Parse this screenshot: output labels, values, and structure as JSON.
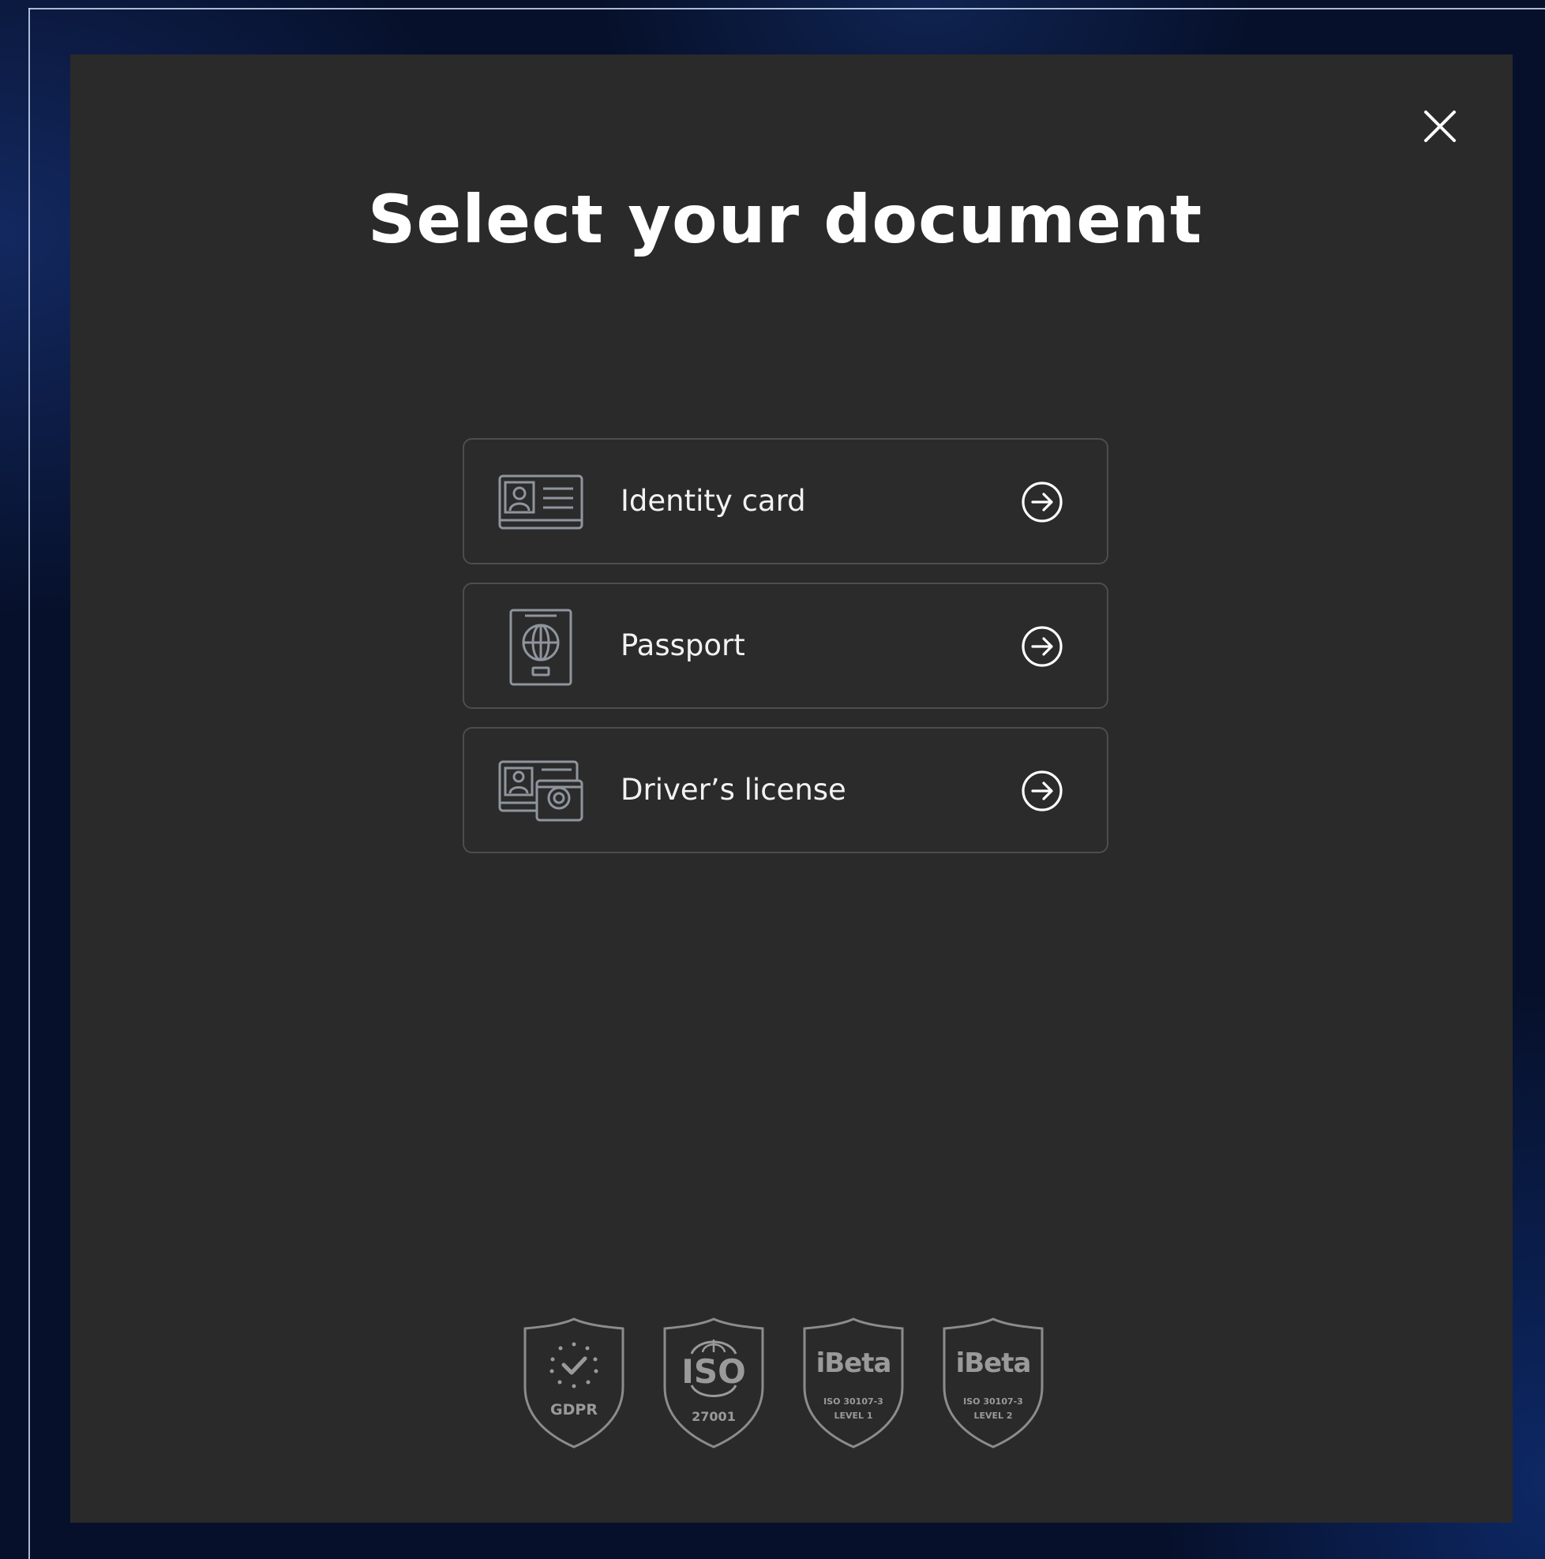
{
  "modal": {
    "title": "Select your document"
  },
  "documents": [
    {
      "label": "Identity card",
      "icon": "id-card-icon"
    },
    {
      "label": "Passport",
      "icon": "passport-icon"
    },
    {
      "label": "Driver’s license",
      "icon": "drivers-license-icon"
    }
  ],
  "badges": [
    {
      "title": "GDPR",
      "subtitle": ""
    },
    {
      "title": "ISO",
      "subtitle": "27001"
    },
    {
      "title": "iBeta",
      "subtitle": "ISO 30107-3",
      "level": "LEVEL 1"
    },
    {
      "title": "iBeta",
      "subtitle": "ISO 30107-3",
      "level": "LEVEL 2"
    }
  ],
  "colors": {
    "modal_background": "#2a2a2a",
    "page_background": "#06102a",
    "option_border": "#4d4d4d",
    "icon_gray": "#8f959e",
    "badge_gray": "#9a9a9a",
    "text": "#ffffff"
  }
}
